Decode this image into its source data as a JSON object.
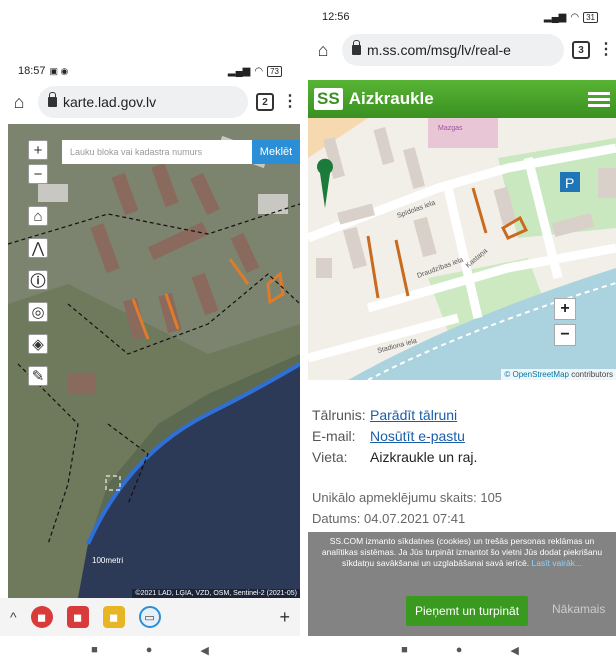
{
  "left": {
    "status": {
      "time": "18:57",
      "battery": "73"
    },
    "url": "karte.lad.gov.lv",
    "tab_count": "2",
    "search": {
      "placeholder": "Lauku bloka vai kadastra numurs",
      "button": "Meklēt"
    },
    "zoom_in": "+",
    "zoom_out": "−",
    "scale_label": "100metri",
    "credit": "©2021 LAD, LĢIA, VZD, OSM, Sentinel-2 (2021-05)",
    "toolbar_up": "^",
    "toolbar_plus": "+"
  },
  "right": {
    "status": {
      "time": "12:56",
      "battery": "31"
    },
    "url": "m.ss.com/msg/lv/real-e",
    "tab_count": "3",
    "logo": "SS",
    "site_name": "Aizkraukle",
    "zoom_in": "+",
    "zoom_out": "−",
    "attribution_link": "© OpenStreetMap",
    "attribution_rest": " contributors",
    "street_labels": [
      "Spīdolas iela",
      "Draudzības iela",
      "Kastaņa",
      "Stadiona iela",
      "Mazgas"
    ],
    "phone_label": "Tālrunis:",
    "phone_value": "Parādīt tālruni",
    "email_label": "E-mail:",
    "email_value": "Nosūtīt e-pastu",
    "place_label": "Vieta:",
    "place_value": "Aizkraukle un raj.",
    "visits": "Unikālo apmeklējumu skaits: 105",
    "date": "Datums: 04.07.2021 07:41",
    "cookie_text": "SS.COM izmanto sīkdatnes (cookies) un trešās personas reklāmas un analītikas sistēmas. Ja Jūs turpināt izmantot šo vietni Jūs dodat piekrišanu sīkdatņu savākšanai un uzglabāšanai savā ierīcē.",
    "cookie_link": "Lasīt vairāk...",
    "accept_button": "Pieņemt un turpināt",
    "reject_button": "Nākamais"
  },
  "colors": {
    "ss_green": "#3a9021",
    "ss_button": "#3a9a20",
    "osm_parcel": "#e07b2a",
    "lad_blue": "#2b8fd8"
  }
}
